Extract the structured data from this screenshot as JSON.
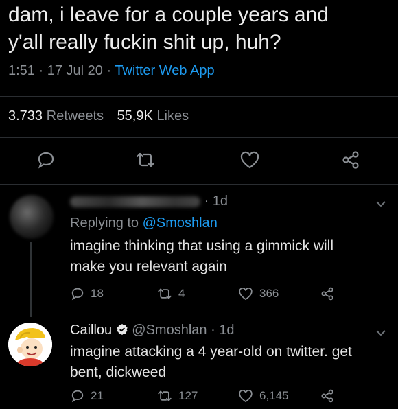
{
  "tweet": {
    "text_line1": "dam, i leave for a couple years and",
    "text_line2": "y'all really fuckin shit up, huh?",
    "time": "1:51",
    "date": "17 Jul 20",
    "source": "Twitter Web App",
    "retweets_count": "3.733",
    "retweets_label": "Retweets",
    "likes_count": "55,9K",
    "likes_label": "Likes"
  },
  "reply1": {
    "time_ago": "1d",
    "replying_prefix": "Replying to",
    "replying_handle": "@Smoshlan",
    "text_line1": "imagine thinking that using a gimmick will",
    "text_line2": "make you relevant again",
    "replies": "18",
    "retweets": "4",
    "likes": "366"
  },
  "reply2": {
    "name": "Caillou",
    "handle": "@Smoshlan",
    "time_ago": "1d",
    "text_line1": "imagine attacking a 4 year-old on twitter. get",
    "text_line2": "bent, dickweed",
    "replies": "21",
    "retweets": "127",
    "likes": "6,145"
  },
  "colors": {
    "background": "#000000",
    "link": "#1d9bf0",
    "muted": "#8b8f94",
    "text": "#ececec"
  },
  "icons": [
    "reply-icon",
    "retweet-icon",
    "like-icon",
    "share-icon",
    "verified-icon",
    "chevron-down-icon"
  ]
}
